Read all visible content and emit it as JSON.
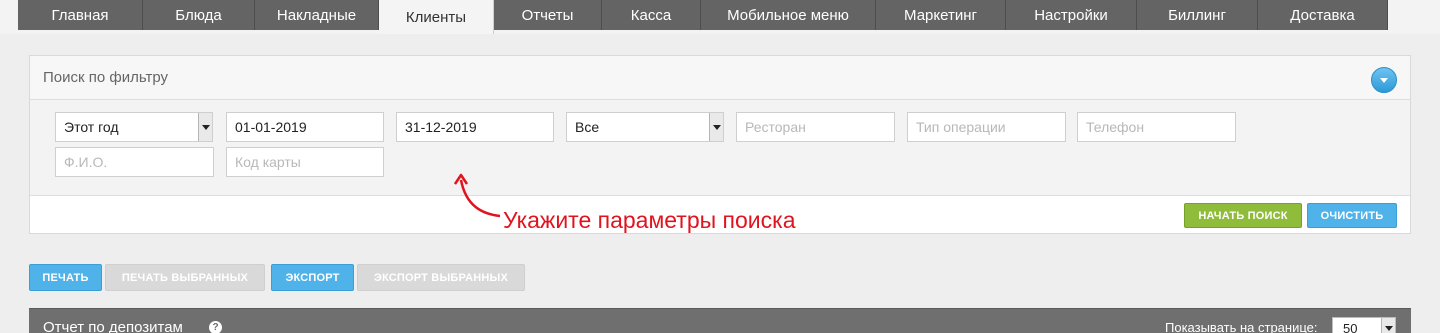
{
  "nav": {
    "tabs": [
      {
        "label": "Главная"
      },
      {
        "label": "Блюда"
      },
      {
        "label": "Накладные"
      },
      {
        "label": "Клиенты",
        "active": true
      },
      {
        "label": "Отчеты"
      },
      {
        "label": "Касса"
      },
      {
        "label": "Мобильное меню"
      },
      {
        "label": "Маркетинг"
      },
      {
        "label": "Настройки"
      },
      {
        "label": "Биллинг"
      },
      {
        "label": "Доставка"
      }
    ]
  },
  "filter": {
    "title": "Поиск по фильтру",
    "period": "Этот год",
    "date_from": "01-01-2019",
    "date_to": "31-12-2019",
    "status": "Все",
    "restaurant_placeholder": "Ресторан",
    "operation_type_placeholder": "Тип операции",
    "phone_placeholder": "Телефон",
    "name_placeholder": "Ф.И.О.",
    "card_code_placeholder": "Код карты",
    "hint": "Укажите параметры поиска",
    "search_button": "НАЧАТЬ ПОИСК",
    "clear_button": "ОЧИСТИТЬ"
  },
  "actions": {
    "print": "ПЕЧАТЬ",
    "print_selected": "ПЕЧАТЬ ВЫБРАННЫХ",
    "export": "ЭКСПОРТ",
    "export_selected": "ЭКСПОРТ ВЫБРАННЫХ"
  },
  "report": {
    "title": "Отчет по депозитам",
    "per_page_label": "Показывать на странице:",
    "per_page_value": "50"
  },
  "colors": {
    "nav_bg": "#646464",
    "accent_blue": "#4fb3ea",
    "accent_green": "#8fbc3a",
    "hint_red": "#e0141f"
  },
  "icons": {
    "collapse": "chevron-down-icon",
    "help": "question-icon",
    "hint_arrow": "curved-arrow-icon"
  }
}
